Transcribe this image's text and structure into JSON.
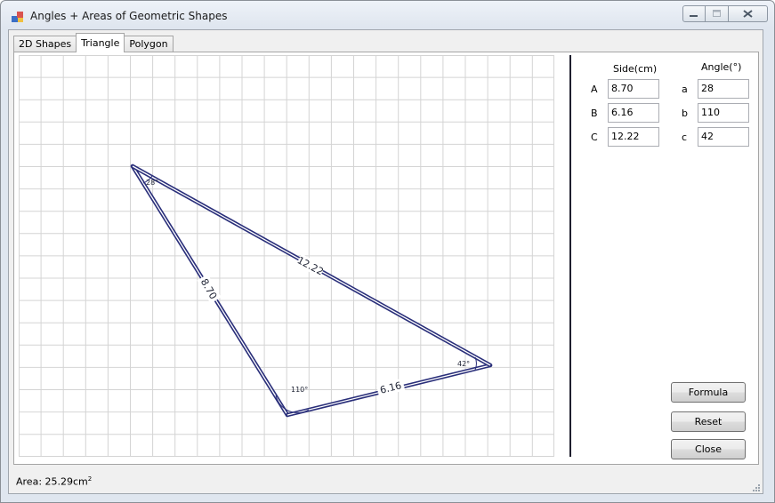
{
  "window": {
    "title": "Angles + Areas of Geometric Shapes"
  },
  "tabs": [
    {
      "label": "2D Shapes"
    },
    {
      "label": "Triangle"
    },
    {
      "label": "Polygon"
    }
  ],
  "triangle": {
    "labels": {
      "side_a": "8.70",
      "side_b": "6.16",
      "side_c": "12.22",
      "angle_a": "28°",
      "angle_b": "110°",
      "angle_c": "42°"
    }
  },
  "panel": {
    "side_header": "Side(cm)",
    "angle_header": "Angle(°)",
    "rows": [
      {
        "side_label": "A",
        "side_value": "8.70",
        "angle_label": "a",
        "angle_value": "28"
      },
      {
        "side_label": "B",
        "side_value": "6.16",
        "angle_label": "b",
        "angle_value": "110"
      },
      {
        "side_label": "C",
        "side_value": "12.22",
        "angle_label": "c",
        "angle_value": "42"
      }
    ]
  },
  "buttons": {
    "formula": "Formula",
    "reset": "Reset",
    "close": "Close"
  },
  "status": {
    "area_prefix": "Area: 25.29cm",
    "area_unit_sup": "2"
  },
  "colors": {
    "triangle_stroke": "#2a2f7a",
    "grid": "#d4d4d4"
  }
}
